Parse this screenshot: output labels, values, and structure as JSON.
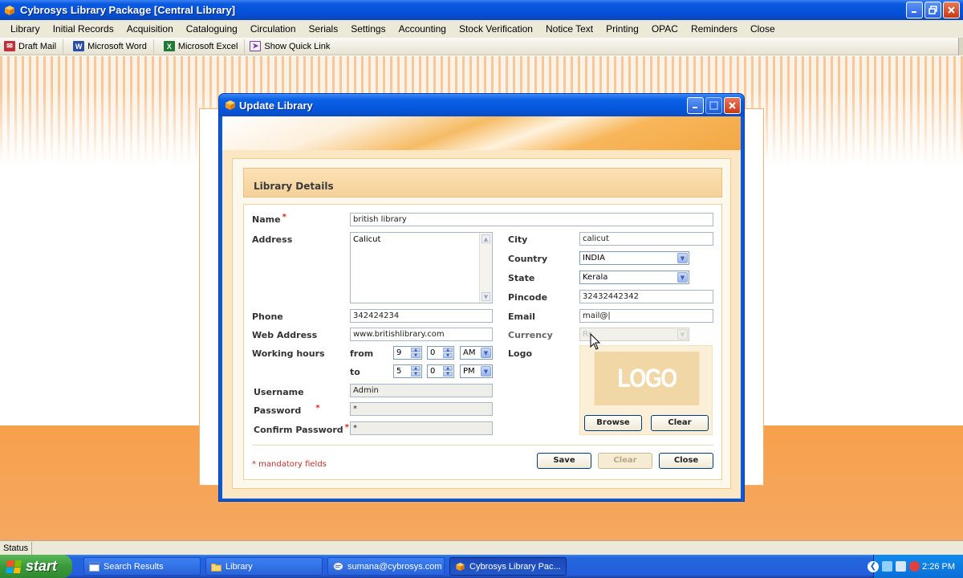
{
  "app": {
    "title": "Cybrosys Library Package [Central Library]"
  },
  "menu": [
    "Library",
    "Initial Records",
    "Acquisition",
    "Cataloguing",
    "Circulation",
    "Serials",
    "Settings",
    "Accounting",
    "Stock Verification",
    "Notice Text",
    "Printing",
    "OPAC",
    "Reminders",
    "Close"
  ],
  "quicklinks": [
    {
      "label": "Draft Mail",
      "icon": "mail-icon",
      "color": "#c0303a"
    },
    {
      "label": "Microsoft Word",
      "icon": "word-icon",
      "color": "#2a4fa8"
    },
    {
      "label": "Microsoft Excel",
      "icon": "excel-icon",
      "color": "#1f7a35"
    },
    {
      "label": "Show Quick Link",
      "icon": "cursor-link-icon",
      "color": "#7a3aa8"
    }
  ],
  "dialog": {
    "title": "Update Library",
    "section_title": "Library Details",
    "labels": {
      "name": "Name",
      "address": "Address",
      "phone": "Phone",
      "web": "Web Address",
      "working_hours": "Working hours",
      "from": "from",
      "to": "to",
      "username": "Username",
      "password": "Password",
      "confirm_password": "Confirm Password",
      "city": "City",
      "country": "Country",
      "state": "State",
      "pincode": "Pincode",
      "email": "Email",
      "currency": "Currency",
      "logo": "Logo"
    },
    "required_mark": "*",
    "values": {
      "name": "british library",
      "address": "Calicut",
      "phone": "342424234",
      "web": "www.britishlibrary.com",
      "from_hour": "9",
      "from_min": "0",
      "from_ampm": "AM",
      "to_hour": "5",
      "to_min": "0",
      "to_ampm": "PM",
      "username": "Admin",
      "password": "*",
      "confirm_password": "*",
      "city": "calicut",
      "country": "INDIA",
      "state": "Kerala",
      "pincode": "32432442342",
      "email": "mail@|",
      "currency": "Rs"
    },
    "logo_text": "LOGO",
    "buttons": {
      "browse": "Browse",
      "logo_clear": "Clear",
      "save": "Save",
      "clear": "Clear",
      "close": "Close"
    },
    "mandatory_note": "* mandatory fields"
  },
  "status": {
    "label": "Status"
  },
  "taskbar": {
    "start": "start",
    "items": [
      {
        "label": "Search Results",
        "active": false
      },
      {
        "label": "Library",
        "active": false
      },
      {
        "label": "sumana@cybrosys.com",
        "active": false
      },
      {
        "label": "Cybrosys Library Pac...",
        "active": true
      }
    ],
    "clock": "2:26 PM"
  }
}
